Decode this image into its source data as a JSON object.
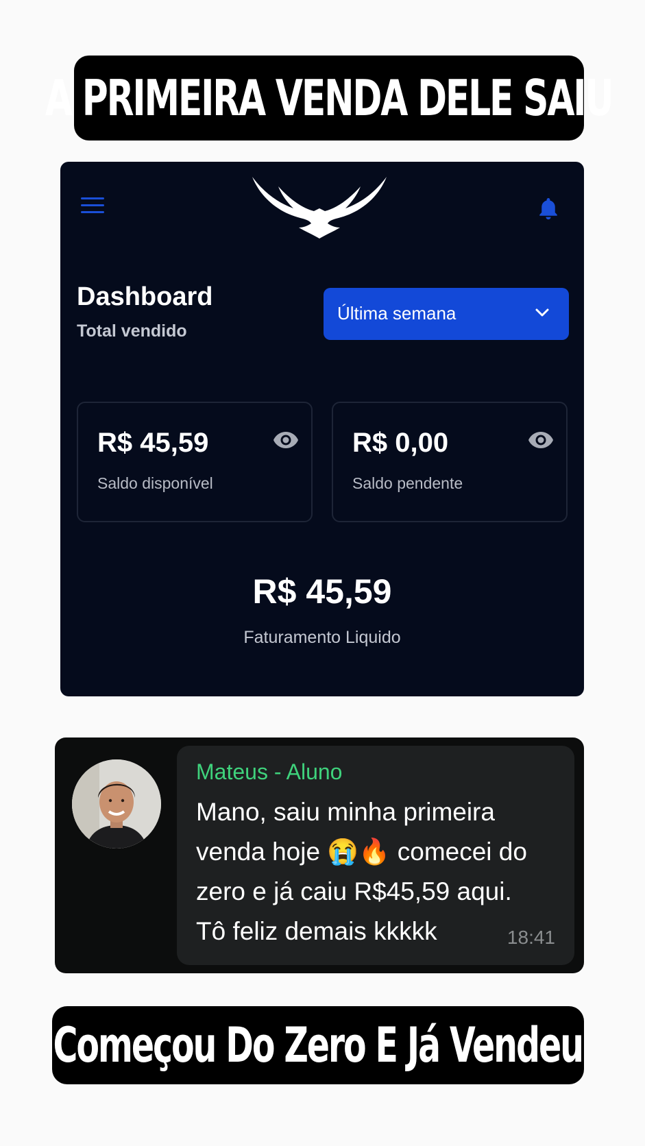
{
  "top_banner": {
    "text": "A PRIMEIRA VENDA DELE SAIU"
  },
  "dashboard": {
    "title": "Dashboard",
    "subtitle": "Total vendido",
    "period_select": {
      "selected": "Última semana"
    },
    "cards": [
      {
        "value": "R$ 45,59",
        "label": "Saldo disponível"
      },
      {
        "value": "R$ 0,00",
        "label": "Saldo pendente"
      }
    ],
    "net": {
      "value": "R$ 45,59",
      "label": "Faturamento Liquido"
    },
    "colors": {
      "background": "#050b1c",
      "accent": "#1349d8"
    },
    "icons": [
      "menu-icon",
      "eagle-logo",
      "bell-icon",
      "chevron-down-icon",
      "eye-icon"
    ]
  },
  "chat": {
    "sender": "Mateus - Aluno",
    "message_lines": [
      "Mano, saiu minha primeira",
      "venda hoje 😭🔥  comecei do",
      "zero e já caiu R$45,59 aqui.",
      "Tô feliz demais kkkkk"
    ],
    "time": "18:41",
    "colors": {
      "sender": "#3fd27c",
      "bubble": "#1e2021"
    }
  },
  "bottom_banner": {
    "text": "Começou Do Zero E Já Vendeu"
  }
}
